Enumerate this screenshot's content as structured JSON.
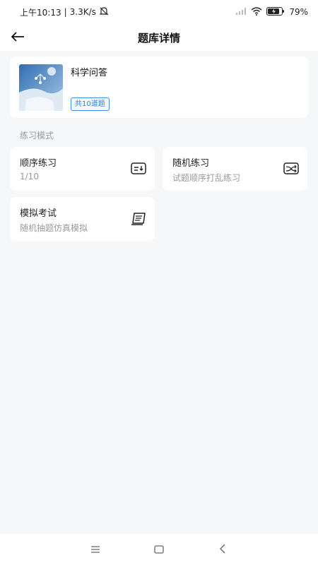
{
  "status_bar": {
    "time": "上午10:13",
    "speed": "3.3K/s",
    "battery": "79%"
  },
  "nav": {
    "title": "题库详情"
  },
  "bank": {
    "name": "科学问答",
    "count_label": "共10道题"
  },
  "section": {
    "label": "练习模式"
  },
  "modes": [
    {
      "title": "顺序练习",
      "subtitle": "1/10",
      "icon": "sequence-icon"
    },
    {
      "title": "随机练习",
      "subtitle": "试题顺序打乱练习",
      "icon": "shuffle-icon"
    },
    {
      "title": "模拟考试",
      "subtitle": "随机抽题仿真模拟",
      "icon": "exam-icon"
    }
  ]
}
